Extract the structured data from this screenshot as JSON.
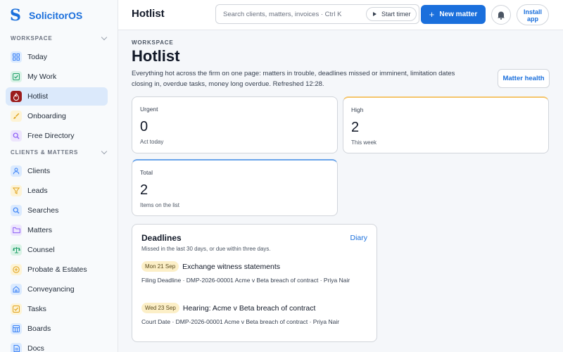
{
  "app": {
    "name": "SolicitorOS",
    "logo_letter": "S"
  },
  "sidebar": {
    "sections": [
      {
        "heading": "WORKSPACE",
        "items": [
          {
            "label": "Today",
            "icon": "grid-icon",
            "color": "#3b82f6",
            "bg": "#dbeafe"
          },
          {
            "label": "My Work",
            "icon": "checkbox-icon",
            "color": "#22a06b",
            "bg": "#d9f2e6"
          },
          {
            "label": "Hotlist",
            "icon": "flame-icon",
            "color": "#ffffff",
            "bg": "#9b1c1c",
            "active": true
          },
          {
            "label": "Onboarding",
            "icon": "brush-icon",
            "color": "#e0a21b",
            "bg": "#fdf3d5"
          },
          {
            "label": "Free Directory",
            "icon": "search-icon",
            "color": "#8b5cf6",
            "bg": "#ede5fd"
          }
        ]
      },
      {
        "heading": "CLIENTS & MATTERS",
        "items": [
          {
            "label": "Clients",
            "icon": "person-icon",
            "color": "#3b82f6",
            "bg": "#dbeafe"
          },
          {
            "label": "Leads",
            "icon": "funnel-icon",
            "color": "#e0a21b",
            "bg": "#fdf3d5"
          },
          {
            "label": "Searches",
            "icon": "search-icon",
            "color": "#3b82f6",
            "bg": "#dbeafe"
          },
          {
            "label": "Matters",
            "icon": "folder-icon",
            "color": "#8b5cf6",
            "bg": "#ede5fd"
          },
          {
            "label": "Counsel",
            "icon": "scales-icon",
            "color": "#22a06b",
            "bg": "#d9f2e6"
          },
          {
            "label": "Probate & Estates",
            "icon": "plus-circle-icon",
            "color": "#e0a21b",
            "bg": "#fdf3d5"
          },
          {
            "label": "Conveyancing",
            "icon": "house-icon",
            "color": "#3b82f6",
            "bg": "#dbeafe"
          },
          {
            "label": "Tasks",
            "icon": "checkbox-icon",
            "color": "#e0a21b",
            "bg": "#fdf3d5"
          },
          {
            "label": "Boards",
            "icon": "board-icon",
            "color": "#3b82f6",
            "bg": "#dbeafe"
          },
          {
            "label": "Docs",
            "icon": "doc-icon",
            "color": "#3b82f6",
            "bg": "#dbeafe"
          }
        ]
      }
    ]
  },
  "header": {
    "title": "Hotlist",
    "search_placeholder": "Search clients, matters, invoices · Ctrl K",
    "start_timer": "Start timer",
    "new_matter": "New matter",
    "install_line1": "Install",
    "install_line2": "app"
  },
  "main": {
    "eyebrow": "WORKSPACE",
    "title": "Hotlist",
    "description": "Everything hot across the firm on one page: matters in trouble, deadlines missed or imminent, limitation dates closing in, overdue tasks, money long overdue. Refreshed 12:28.",
    "matter_health": "Matter health",
    "stats": {
      "urgent": {
        "label": "Urgent",
        "value": "0",
        "sub": "Act today"
      },
      "high": {
        "label": "High",
        "value": "2",
        "sub": "This week"
      },
      "total": {
        "label": "Total",
        "value": "2",
        "sub": "Items on the list"
      }
    },
    "deadlines": {
      "heading": "Deadlines",
      "diary_link": "Diary",
      "subtitle": "Missed in the last 30 days, or due within three days.",
      "items": [
        {
          "date": "Mon 21 Sep",
          "title": "Exchange witness statements",
          "meta": "Filing Deadline · DMP-2026-00001 Acme v Beta breach of contract · Priya Nair"
        },
        {
          "date": "Wed 23 Sep",
          "title": "Hearing: Acme v Beta breach of contract",
          "meta": "Court Date · DMP-2026-00001 Acme v Beta breach of contract · Priya Nair"
        }
      ]
    }
  },
  "colors": {
    "accent": "#1a6fdc",
    "active_bg": "#dbe9fb",
    "pill_bg": "#fcefc7"
  }
}
